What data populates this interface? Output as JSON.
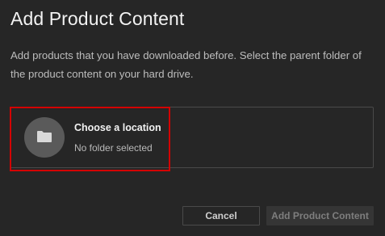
{
  "dialog": {
    "title": "Add Product Content",
    "description": "Add products that you have downloaded before. Select the parent folder of the product content on your hard drive."
  },
  "location_picker": {
    "icon": "folder-icon",
    "label": "Choose a location",
    "status": "No folder selected"
  },
  "buttons": {
    "cancel_label": "Cancel",
    "add_label": "Add Product Content",
    "add_enabled": false
  },
  "colors": {
    "background": "#262626",
    "highlight_border": "#d40000",
    "icon_circle": "#5a5a5a"
  }
}
